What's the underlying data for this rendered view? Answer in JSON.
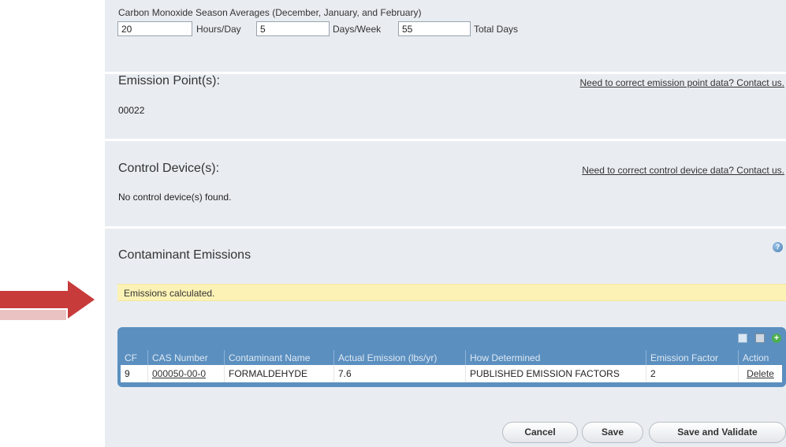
{
  "season": {
    "title": "Carbon Monoxide Season Averages (December, January, and February)",
    "hours_per_day": "20",
    "hours_label": "Hours/Day",
    "days_per_week": "5",
    "days_label": "Days/Week",
    "total_days": "55",
    "total_label": "Total Days"
  },
  "emission_points": {
    "title": "Emission Point(s):",
    "link": "Need to correct emission point data? Contact us.",
    "value": "00022"
  },
  "control_devices": {
    "title": "Control Device(s):",
    "link": "Need to correct control device data? Contact us.",
    "value": "No control device(s) found."
  },
  "contaminant": {
    "title": "Contaminant Emissions",
    "notice": "Emissions calculated.",
    "columns": [
      "CF",
      "CAS Number",
      "Contaminant Name",
      "Actual Emission (lbs/yr)",
      "How Determined",
      "Emission Factor",
      "Action"
    ],
    "rows": [
      {
        "cf": "9",
        "cas": "000050-00-0",
        "name": "FORMALDEHYDE",
        "actual": "7.6",
        "how": "PUBLISHED EMISSION FACTORS",
        "factor": "2",
        "action": "Delete"
      }
    ]
  },
  "buttons": {
    "cancel": "Cancel",
    "save": "Save",
    "save_validate": "Save and Validate"
  },
  "icons": {
    "help": "help-icon",
    "copy": "copy-icon",
    "calculator": "calculator-icon",
    "add": "add-icon",
    "arrow": "red-arrow-icon"
  },
  "colors": {
    "panel": "#e9edf2",
    "notice": "#fcf2b5",
    "grid_header": "#5b8fbf",
    "arrow": "#c0392b"
  }
}
